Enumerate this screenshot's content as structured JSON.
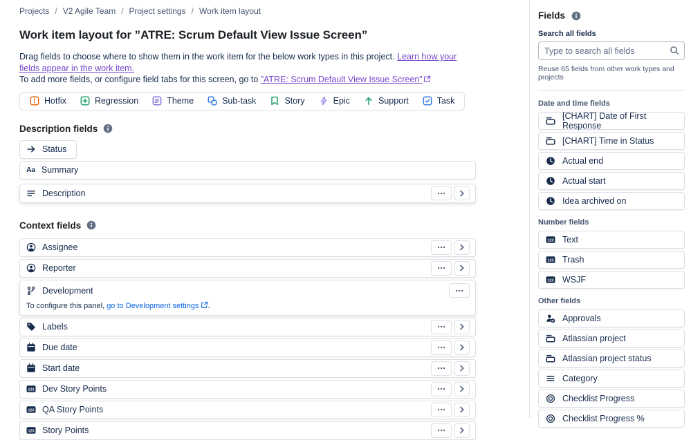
{
  "colors": {
    "link_purple": "#7446CB",
    "link_blue": "#0C66E4",
    "hotfix": "#E56910",
    "regression": "#22A06B",
    "theme": "#8270DB",
    "subtask": "#357DE8",
    "story": "#22A06B",
    "epic": "#8F7EE7",
    "support": "#22A06B",
    "task": "#357DE8"
  },
  "breadcrumb": {
    "separator": "/",
    "items": [
      "Projects",
      "V2 Agile Team",
      "Project settings",
      "Work item layout"
    ]
  },
  "header": {
    "title": "Work item layout for ”ATRE: Scrum Default View Issue Screen”",
    "intro_line1": "Drag fields to choose where to show them in the work item for the below work types in this project.",
    "intro_link1": "Learn how your fields appear in the work item.",
    "intro_line2": "To add more fields, or configure field tabs for this screen, go to",
    "intro_link2": "”ATRE: Scrum Default View Issue Screen”"
  },
  "work_type_tabs": [
    {
      "label": "Hotfix",
      "color": "#E56910"
    },
    {
      "label": "Regression",
      "color": "#22A06B"
    },
    {
      "label": "Theme",
      "color": "#8270DB"
    },
    {
      "label": "Sub-task",
      "color": "#357DE8"
    },
    {
      "label": "Story",
      "color": "#22A06B"
    },
    {
      "label": "Epic",
      "color": "#8F7EE7"
    },
    {
      "label": "Support",
      "color": "#22A06B"
    },
    {
      "label": "Task",
      "color": "#357DE8"
    }
  ],
  "description_fields": {
    "heading": "Description fields",
    "items": [
      {
        "label": "Status"
      },
      {
        "label": "Summary"
      },
      {
        "label": "Description"
      }
    ]
  },
  "context_fields": {
    "heading": "Context fields",
    "items": [
      {
        "label": "Assignee"
      },
      {
        "label": "Reporter"
      },
      {
        "label": "Development",
        "note_prefix": "To configure this panel, ",
        "note_link": "go to Development settings",
        "note_suffix": "."
      },
      {
        "label": "Labels"
      },
      {
        "label": "Due date"
      },
      {
        "label": "Start date"
      },
      {
        "label": "Dev Story Points"
      },
      {
        "label": "QA Story Points"
      },
      {
        "label": "Story Points"
      }
    ]
  },
  "sidebar": {
    "heading": "Fields",
    "search_label": "Search all fields",
    "search_placeholder": "Type to search all fields",
    "reuse_note": "Reuse 65 fields from other work types and projects",
    "groups": [
      {
        "heading": "Date and time fields",
        "items": [
          {
            "label": "[CHART] Date of First Response"
          },
          {
            "label": "[CHART] Time in Status"
          },
          {
            "label": "Actual end"
          },
          {
            "label": "Actual start"
          },
          {
            "label": "Idea archived on"
          }
        ]
      },
      {
        "heading": "Number fields",
        "items": [
          {
            "label": "Text"
          },
          {
            "label": "Trash"
          },
          {
            "label": "WSJF"
          }
        ]
      },
      {
        "heading": "Other fields",
        "items": [
          {
            "label": "Approvals"
          },
          {
            "label": "Atlassian project"
          },
          {
            "label": "Atlassian project status"
          },
          {
            "label": "Category"
          },
          {
            "label": "Checklist Progress"
          },
          {
            "label": "Checklist Progress %"
          }
        ]
      }
    ]
  }
}
